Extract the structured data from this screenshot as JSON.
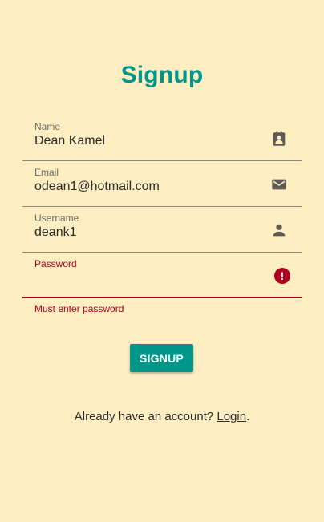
{
  "colors": {
    "background": "#FFEEC2",
    "accent": "#00968A",
    "error": "#B00020",
    "text": "#2B2B2B",
    "label": "#6B6B6B",
    "line": "#8D8A7F"
  },
  "page": {
    "title": "Signup"
  },
  "form": {
    "fields": [
      {
        "label": "Name",
        "value": "Dean Kamel",
        "icon": "contact-card-icon"
      },
      {
        "label": "Email",
        "value": "odean1@hotmail.com",
        "icon": "email-icon"
      },
      {
        "label": "Username",
        "value": "deank1",
        "icon": "person-icon"
      },
      {
        "label": "Password",
        "value": "",
        "icon": "error-icon",
        "error_text": "Must enter password"
      }
    ],
    "error_icon_glyph": "!",
    "submit_label": "SIGNUP"
  },
  "footer": {
    "prompt": "Already have an account? ",
    "link": "Login",
    "suffix": "."
  }
}
